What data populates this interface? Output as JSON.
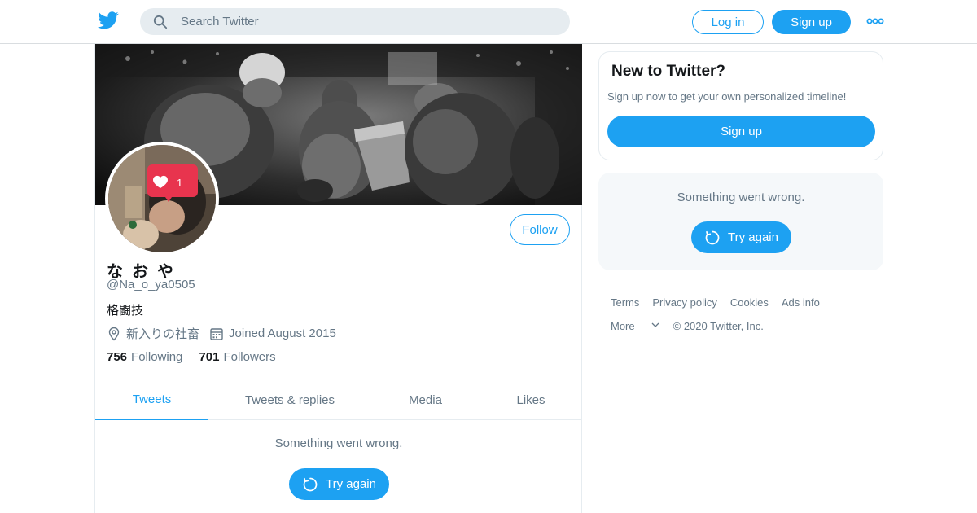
{
  "header": {
    "logo_icon": "twitter-bird-icon",
    "search_placeholder": "Search Twitter",
    "login_label": "Log in",
    "signup_label": "Sign up",
    "more_icon": "more-dots-icon"
  },
  "profile": {
    "display_name": "な お や",
    "handle": "@Na_o_ya0505",
    "bio": "格闘技",
    "location": "新入りの社畜",
    "joined": "Joined August 2015",
    "following_count": "756",
    "following_label": "Following",
    "followers_count": "701",
    "followers_label": "Followers",
    "follow_label": "Follow",
    "avatar_like_badge": "1"
  },
  "tabs": [
    {
      "label": "Tweets",
      "active": true
    },
    {
      "label": "Tweets & replies",
      "active": false
    },
    {
      "label": "Media",
      "active": false
    },
    {
      "label": "Likes",
      "active": false
    }
  ],
  "timeline": {
    "error_text": "Something went wrong.",
    "retry_label": "Try again"
  },
  "sidebar": {
    "new_title": "New to Twitter?",
    "new_subtitle": "Sign up now to get your own personalized timeline!",
    "signup_label": "Sign up",
    "error_text": "Something went wrong.",
    "retry_label": "Try again"
  },
  "footer": {
    "links": [
      "Terms",
      "Privacy policy",
      "Cookies",
      "Ads info"
    ],
    "more_label": "More",
    "copyright": "© 2020 Twitter, Inc."
  },
  "colors": {
    "accent": "#1da1f2",
    "muted_text": "#657786",
    "border": "#e6ecf0",
    "panel_bg": "#f5f8fa",
    "search_bg": "#e6ecf0"
  }
}
